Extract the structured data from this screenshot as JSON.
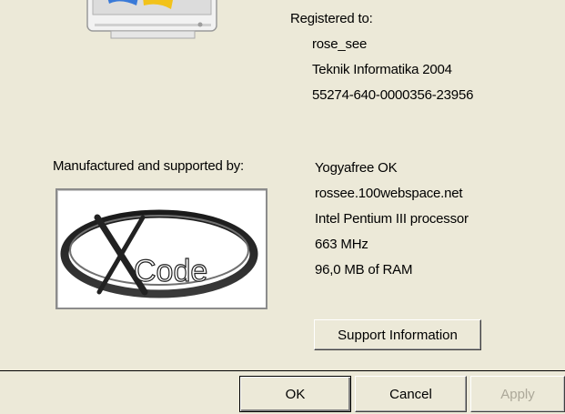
{
  "registration": {
    "heading": "Registered to:",
    "user": "rose_see",
    "organization": "Teknik Informatika 2004",
    "product_id": "55274-640-0000356-23956"
  },
  "manufacturer": {
    "heading": "Manufactured and supported by:",
    "logo_text": "Code",
    "logo_letter": "X",
    "lines": [
      "Yogyafree OK",
      "rossee.100webspace.net",
      "Intel Pentium III processor",
      "663 MHz",
      "96,0 MB of RAM"
    ]
  },
  "buttons": {
    "support": "Support Information",
    "ok": "OK",
    "cancel": "Cancel",
    "apply": "Apply"
  },
  "colors": {
    "background": "#ece9d8",
    "disabled_text": "#aca899"
  }
}
